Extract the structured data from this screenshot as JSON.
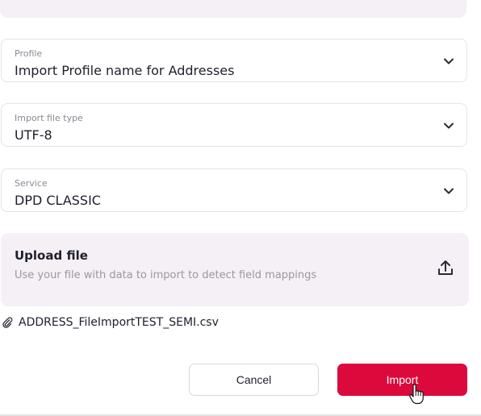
{
  "fields": [
    {
      "label": "Profile",
      "value": "Import Profile name for Addresses"
    },
    {
      "label": "Import file type",
      "value": "UTF-8"
    },
    {
      "label": "Service",
      "value": "DPD CLASSIC"
    }
  ],
  "upload": {
    "title": "Upload file",
    "description": "Use your file with data to import to detect field mappings",
    "icon": "upload-icon"
  },
  "attachment": {
    "icon": "paperclip-icon",
    "filename": "ADDRESS_FileImportTEST_SEMI.csv"
  },
  "actions": {
    "cancel_label": "Cancel",
    "import_label": "Import"
  },
  "colors": {
    "primary": "#dc0a3c",
    "panel_bg": "#f4f0f6",
    "border": "#e6e3ea"
  }
}
